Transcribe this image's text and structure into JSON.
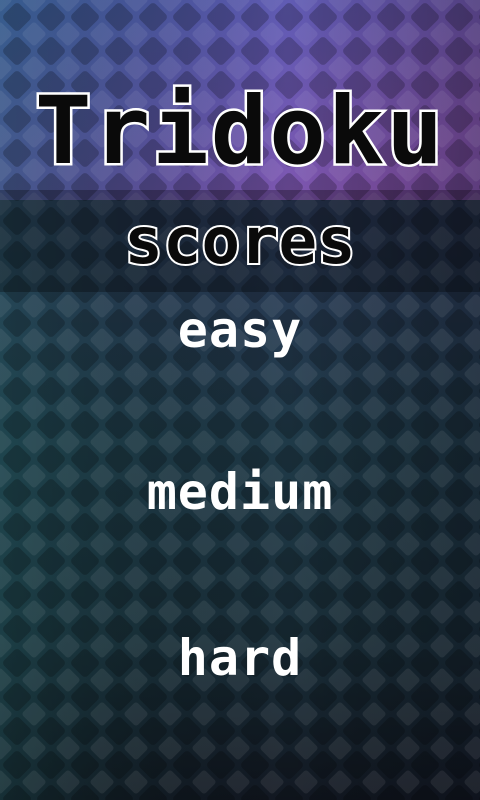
{
  "app": {
    "title": "Tridoku",
    "screen_title": "scores"
  },
  "menu": {
    "easy": "easy",
    "medium": "medium",
    "hard": "hard"
  },
  "colors": {
    "top_purple": "#7a4fb0",
    "mid_teal": "#2a4a5a",
    "bottom_dark": "#141a26",
    "text_white": "#ffffff",
    "title_fill": "#0a0a0a"
  }
}
